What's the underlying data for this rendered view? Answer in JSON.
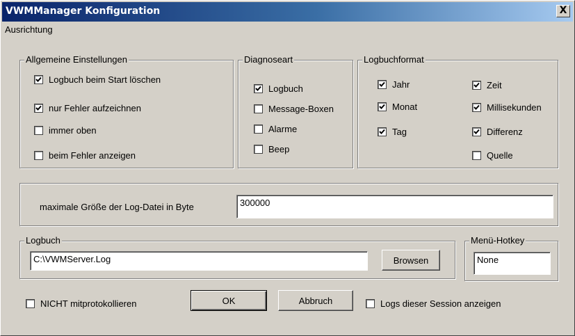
{
  "window": {
    "title": "VWMManager Konfiguration",
    "close_label": "X"
  },
  "menubar": {
    "items": [
      "Ausrichtung"
    ]
  },
  "general": {
    "title": "Allgemeine Einstellungen",
    "options": [
      {
        "label": "Logbuch beim Start löschen",
        "checked": true
      },
      {
        "label": "nur Fehler aufzeichnen",
        "checked": true
      },
      {
        "label": "immer oben",
        "checked": false
      },
      {
        "label": "beim Fehler anzeigen",
        "checked": false
      }
    ]
  },
  "diagnose": {
    "title": "Diagnoseart",
    "options": [
      {
        "label": "Logbuch",
        "checked": true
      },
      {
        "label": "Message-Boxen",
        "checked": false
      },
      {
        "label": "Alarme",
        "checked": false
      },
      {
        "label": "Beep",
        "checked": false
      }
    ]
  },
  "logformat": {
    "title": "Logbuchformat",
    "left": [
      {
        "label": "Jahr",
        "checked": true
      },
      {
        "label": "Monat",
        "checked": true
      },
      {
        "label": "Tag",
        "checked": true
      }
    ],
    "right": [
      {
        "label": "Zeit",
        "checked": true
      },
      {
        "label": "Millisekunden",
        "checked": true
      },
      {
        "label": "Differenz",
        "checked": true
      },
      {
        "label": "Quelle",
        "checked": false
      }
    ]
  },
  "maxsize": {
    "label": "maximale Größe der Log-Datei in Byte",
    "value": "300000"
  },
  "logbook": {
    "title": "Logbuch",
    "path": "C:\\VWMServer.Log",
    "browse_label": "Browsen"
  },
  "hotkey": {
    "title": "Menü-Hotkey",
    "value": "None"
  },
  "bottom": {
    "no_log_label": "NICHT mitprotokollieren",
    "no_log_checked": false,
    "ok_label": "OK",
    "cancel_label": "Abbruch",
    "session_label": "Logs dieser Session anzeigen",
    "session_checked": false
  }
}
